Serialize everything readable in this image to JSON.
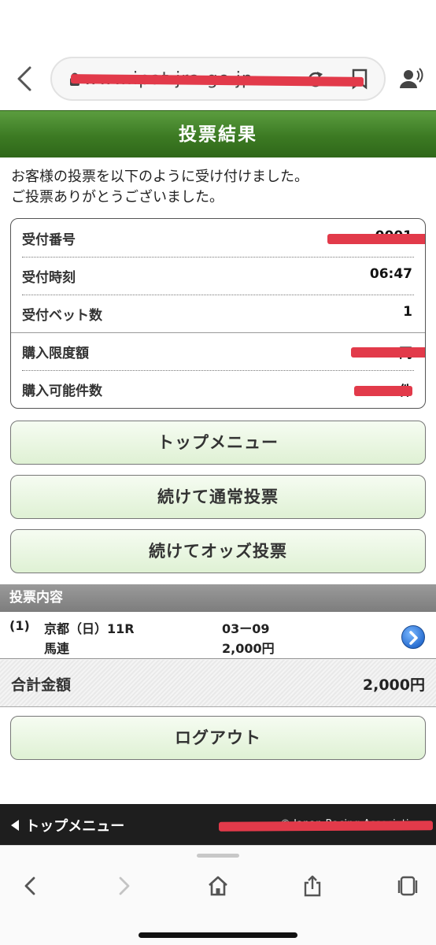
{
  "browser": {
    "url": "www.ipat.jra.go.jp"
  },
  "header": {
    "title": "投票結果"
  },
  "message": {
    "line1": "お客様の投票を以下のように受け付けました。",
    "line2": "ご投票ありがとうございました。"
  },
  "info": {
    "rows": [
      {
        "label": "受付番号",
        "value": "0001"
      },
      {
        "label": "受付時刻",
        "value": "06:47"
      },
      {
        "label": "受付ベット数",
        "value": "1"
      },
      {
        "label": "購入限度額",
        "value": "円"
      },
      {
        "label": "購入可能件数",
        "value": "件"
      }
    ]
  },
  "buttons": {
    "top_menu": "トップメニュー",
    "continue_normal": "続けて通常投票",
    "continue_odds": "続けてオッズ投票",
    "logout": "ログアウト"
  },
  "bet_section": {
    "title": "投票内容",
    "index": "(1)",
    "race": "京都（日）11R",
    "type": "馬連",
    "combo": "03ー09",
    "amount": "2,000円"
  },
  "total": {
    "label": "合計金額",
    "value": "2,000円"
  },
  "footer": {
    "link": "トップメニュー",
    "copyright": "© Japan Racing Association"
  }
}
